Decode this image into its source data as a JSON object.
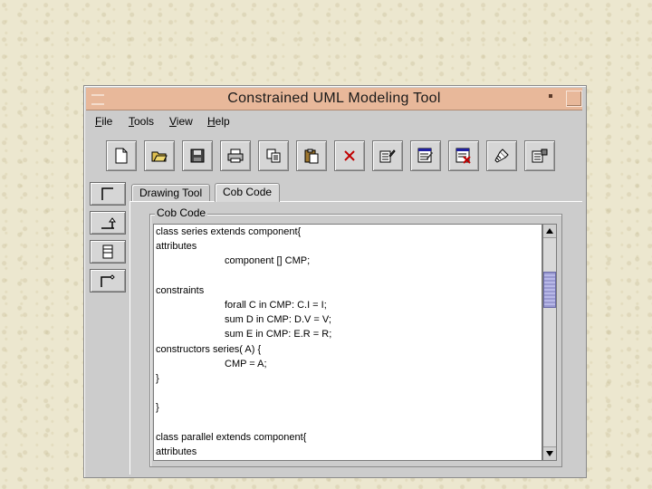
{
  "window": {
    "title": "Constrained UML Modeling Tool"
  },
  "menu": [
    {
      "label": "File",
      "u": "F",
      "rest": "ile"
    },
    {
      "label": "Tools",
      "u": "T",
      "rest": "ools"
    },
    {
      "label": "View",
      "u": "V",
      "rest": "iew"
    },
    {
      "label": "Help",
      "u": "H",
      "rest": "elp"
    }
  ],
  "toolbar_icons": [
    "new-icon",
    "open-icon",
    "save-icon",
    "print-icon",
    "copy-icon",
    "paste-icon",
    "delete-icon",
    "properties-icon",
    "edit-icon",
    "remove-icon",
    "brush-icon",
    "settings-icon"
  ],
  "left_tools": [
    "class-tool-icon",
    "generalization-tool-icon",
    "attribute-tool-icon",
    "association-tool-icon"
  ],
  "tabs": [
    {
      "label": "Drawing Tool",
      "active": false
    },
    {
      "label": "Cob Code",
      "active": true
    }
  ],
  "panel": {
    "title": "Cob Code",
    "code_lines": [
      {
        "text": "class series extends component{",
        "indent": false
      },
      {
        "text": "attributes",
        "indent": false
      },
      {
        "text": "component [] CMP;",
        "indent": true
      },
      {
        "text": "",
        "indent": false
      },
      {
        "text": "constraints",
        "indent": false
      },
      {
        "text": "forall C in CMP: C.I = I;",
        "indent": true
      },
      {
        "text": "sum D in CMP: D.V = V;",
        "indent": true
      },
      {
        "text": "sum E in CMP: E.R = R;",
        "indent": true
      },
      {
        "text": "constructors series( A) {",
        "indent": false
      },
      {
        "text": "CMP = A;",
        "indent": true
      },
      {
        "text": "}",
        "indent": false
      },
      {
        "text": "",
        "indent": false
      },
      {
        "text": "}",
        "indent": false
      },
      {
        "text": "",
        "indent": false
      },
      {
        "text": "class parallel extends component{",
        "indent": false
      },
      {
        "text": "attributes",
        "indent": false
      }
    ]
  },
  "colors": {
    "titlebar": "#e8b89a",
    "scroll_thumb": "#a8a8e0"
  }
}
